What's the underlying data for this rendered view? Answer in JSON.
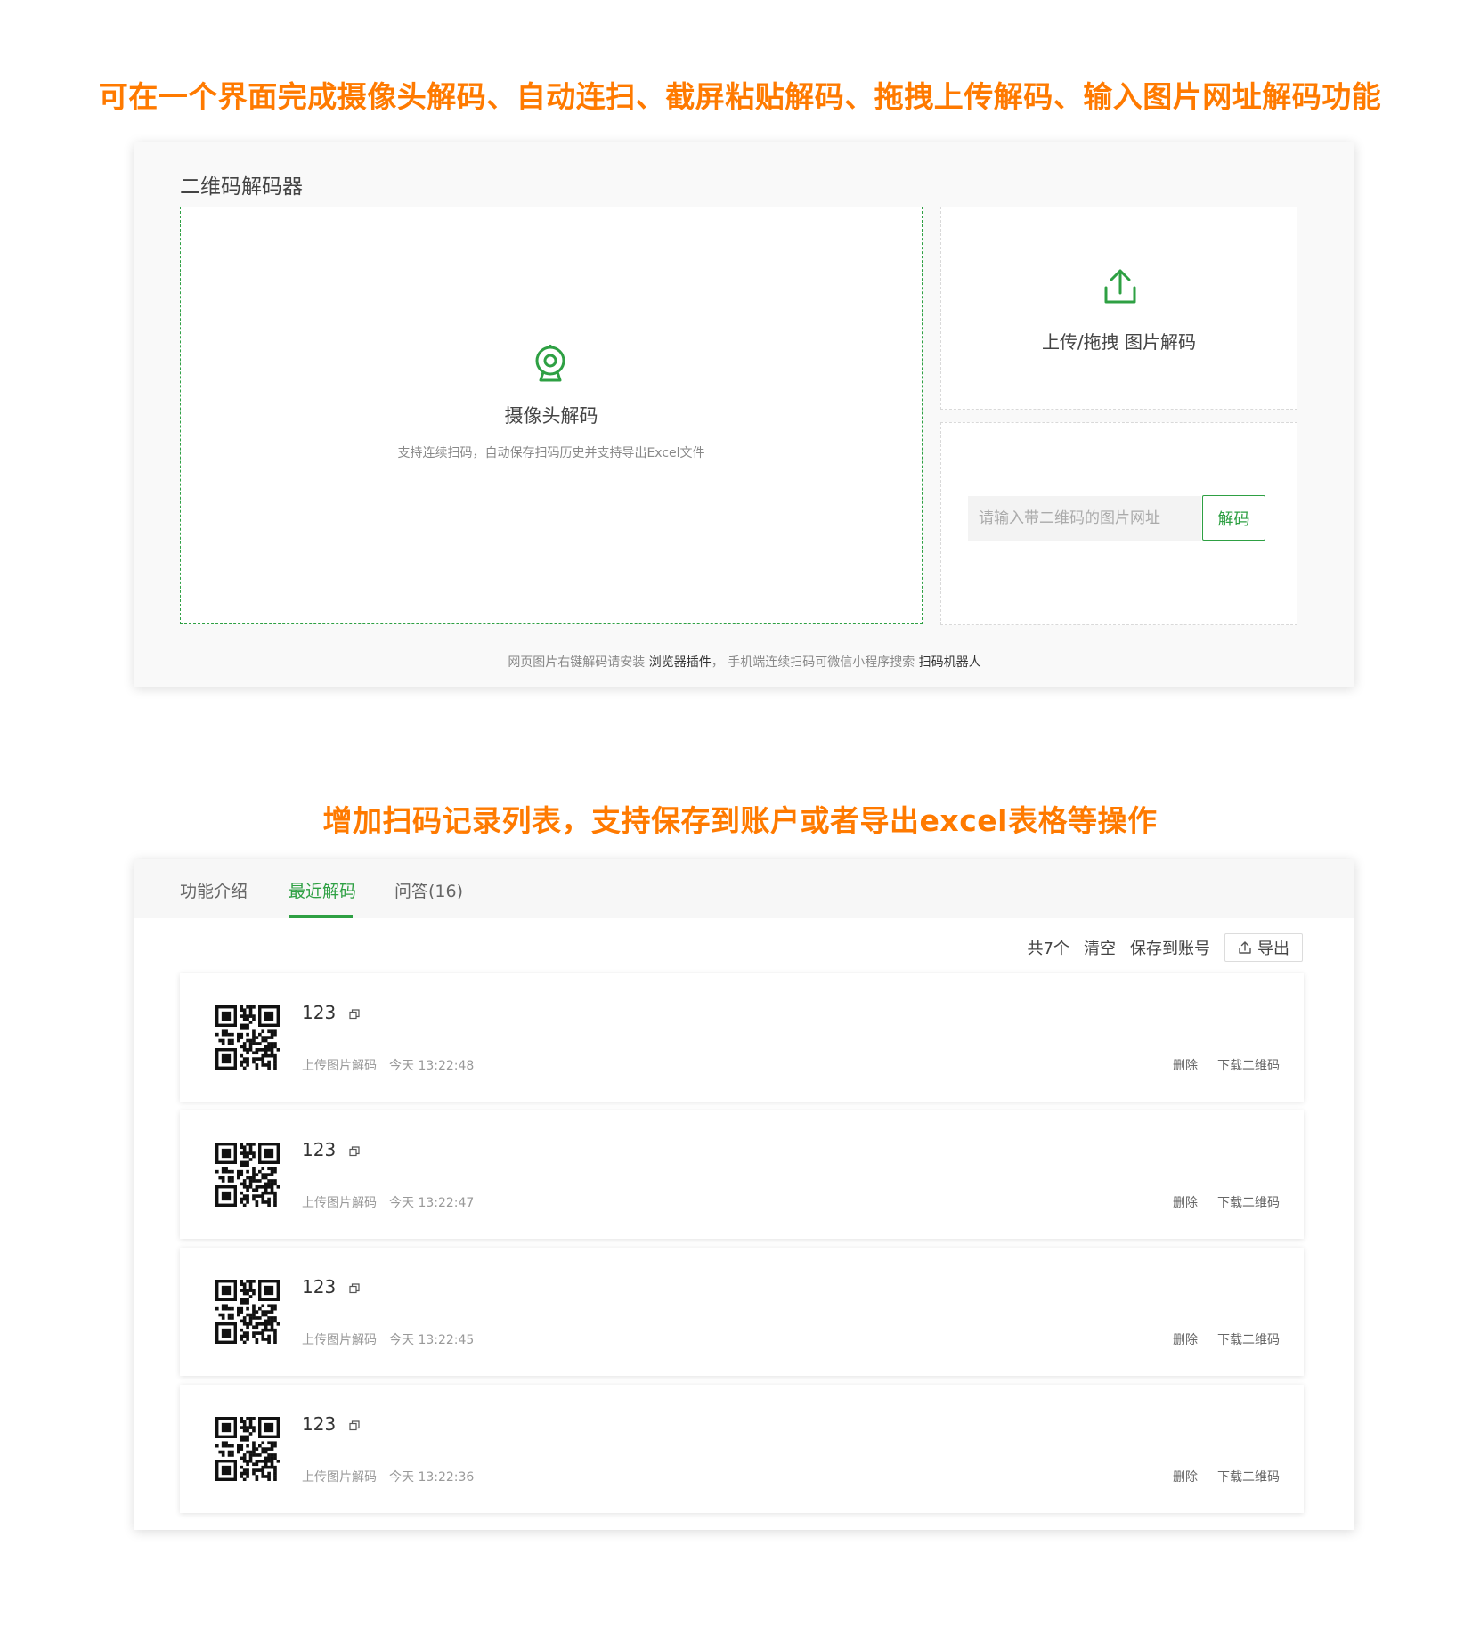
{
  "headlines": {
    "top": "可在一个界面完成摄像头解码、自动连扫、截屏粘贴解码、拖拽上传解码、输入图片网址解码功能",
    "bottom": "增加扫码记录列表，支持保存到账户或者导出excel表格等操作"
  },
  "decoder": {
    "title": "二维码解码器",
    "camera": {
      "icon": "webcam-icon",
      "label": "摄像头解码",
      "description": "支持连续扫码，自动保存扫码历史并支持导出Excel文件"
    },
    "upload": {
      "icon": "upload-icon",
      "label": "上传/拖拽 图片解码"
    },
    "url_input": {
      "placeholder": "请输入带二维码的图片网址",
      "value": "",
      "button_label": "解码"
    },
    "footer": {
      "text_1": "网页图片右键解码请安装 ",
      "link_1": "浏览器插件",
      "text_2": "， 手机端连续扫码可微信小程序搜索 ",
      "link_2": "扫码机器人"
    }
  },
  "history": {
    "tabs": [
      {
        "label": "功能介绍",
        "active": false
      },
      {
        "label": "最近解码",
        "active": true
      },
      {
        "label": "问答(16)",
        "active": false
      }
    ],
    "toolbar": {
      "count": "共7个",
      "clear": "清空",
      "save": "保存到账号",
      "export": "导出"
    },
    "records": [
      {
        "content": "123",
        "source": "上传图片解码",
        "time": "今天 13:22:48",
        "delete": "删除",
        "download": "下载二维码"
      },
      {
        "content": "123",
        "source": "上传图片解码",
        "time": "今天 13:22:47",
        "delete": "删除",
        "download": "下载二维码"
      },
      {
        "content": "123",
        "source": "上传图片解码",
        "time": "今天 13:22:45",
        "delete": "删除",
        "download": "下载二维码"
      },
      {
        "content": "123",
        "source": "上传图片解码",
        "time": "今天 13:22:36",
        "delete": "删除",
        "download": "下载二维码"
      }
    ]
  },
  "colors": {
    "accent": "#2ea043",
    "headline": "#ff7a00"
  }
}
